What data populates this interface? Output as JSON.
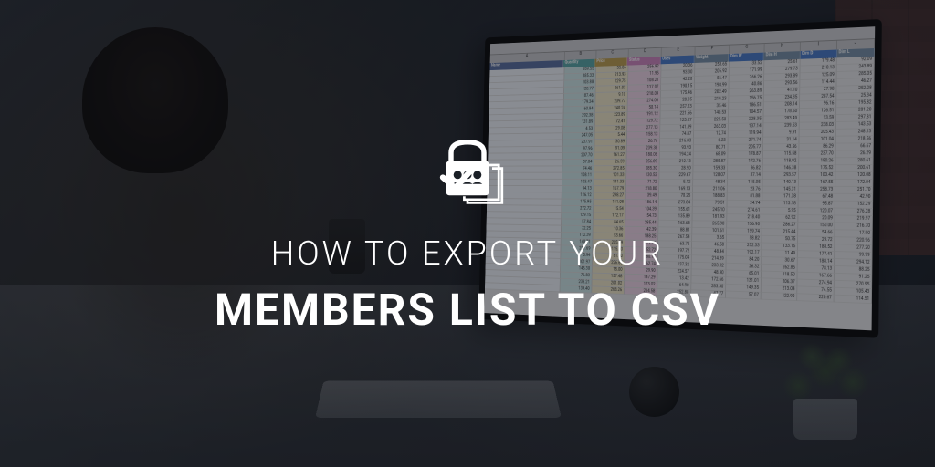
{
  "title": {
    "line1": "HOW TO EXPORT YOUR",
    "line2": "MEMBERS LIST TO CSV"
  },
  "logo_name": "paid-memberships-pro-logo",
  "spreadsheet": {
    "col_letters": [
      "A",
      "B",
      "C",
      "D",
      "E",
      "F",
      "G",
      "H",
      "I",
      "J"
    ],
    "labels": [
      "Name",
      "Quantity",
      "Price",
      "Status",
      "Uses",
      "Weight",
      "Dim W",
      "Dim H",
      "Dim D",
      "Dim L"
    ]
  }
}
